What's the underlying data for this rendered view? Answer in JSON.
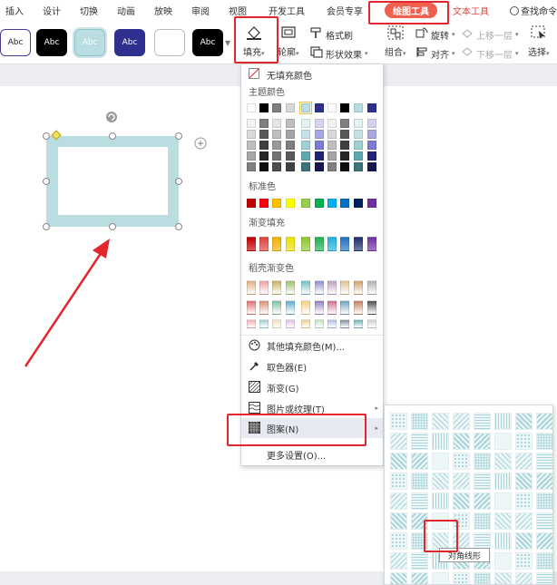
{
  "tabs": [
    "插入",
    "设计",
    "切换",
    "动画",
    "放映",
    "审阅",
    "视图",
    "开发工具",
    "会员专享",
    "绘图工具",
    "文本工具"
  ],
  "search_label": "查找命令",
  "style_swatches": [
    {
      "label": "Abc",
      "bg": "#ffffff",
      "fg": "#222222",
      "border": "#4a3b9a"
    },
    {
      "label": "Abc",
      "bg": "#000000",
      "fg": "#ffffff",
      "border": "#000000"
    },
    {
      "label": "Abc",
      "bg": "#b9dde0",
      "fg": "#ffffff",
      "border": "#8cc5ca"
    },
    {
      "label": "Abc",
      "bg": "#2f2f8f",
      "fg": "#ffffff",
      "border": "#2f2f8f"
    },
    {
      "label": "",
      "bg": "#ffffff",
      "fg": "#222222",
      "border": "#bbbbbb"
    },
    {
      "label": "Abc",
      "bg": "#000000",
      "fg": "#ffffff",
      "border": "#000000"
    }
  ],
  "toolbar": {
    "fill_label": "填充",
    "outline_label": "轮廓",
    "format_painter_label": "格式刷",
    "shape_effect_label": "形状效果",
    "rotate_label": "旋转",
    "bring_forward_label": "上移一层",
    "send_backward_label": "下移一层",
    "group_label": "组合",
    "align_label": "对齐",
    "select_label": "选择"
  },
  "fill_menu": {
    "no_fill": "无填充颜色",
    "theme_colors_title": "主题颜色",
    "standard_colors_title": "标准色",
    "gradient_fill_title": "渐变填充",
    "shell_gradient_title": "稻壳渐变色",
    "more_fill_colors": "其他填充颜色(M)...",
    "eyedropper": "取色器(E)",
    "gradient": "渐变(G)",
    "picture_texture": "图片或纹理(T)",
    "pattern": "图案(N)",
    "more_settings": "更多设置(O)..."
  },
  "theme_top_row": [
    "#ffffff",
    "#000000",
    "#7f7f7f",
    "#d9d9d9",
    "#b9dde0",
    "#2f2f8f",
    "#ffffff",
    "#000000",
    "#b9dde0",
    "#2f2f8f"
  ],
  "theme_columns": [
    [
      "#f2f2f2",
      "#d9d9d9",
      "#bfbfbf",
      "#a6a6a6",
      "#808080"
    ],
    [
      "#7f7f7f",
      "#595959",
      "#404040",
      "#262626",
      "#0d0d0d"
    ],
    [
      "#e6e6e6",
      "#bfbfbf",
      "#999999",
      "#737373",
      "#4d4d4d"
    ],
    [
      "#bfbfbf",
      "#a6a6a6",
      "#7f7f7f",
      "#595959",
      "#404040"
    ],
    [
      "#e2f1f2",
      "#c5e3e6",
      "#9fd0d4",
      "#5da9b0",
      "#3b7479"
    ],
    [
      "#d3d3f0",
      "#a7a7e1",
      "#7c7cd2",
      "#232376",
      "#17174f"
    ],
    [
      "#f2f2f2",
      "#d9d9d9",
      "#bfbfbf",
      "#a6a6a6",
      "#808080"
    ],
    [
      "#7f7f7f",
      "#595959",
      "#404040",
      "#262626",
      "#0d0d0d"
    ],
    [
      "#e2f1f2",
      "#c5e3e6",
      "#9fd0d4",
      "#5da9b0",
      "#3b7479"
    ],
    [
      "#d3d3f0",
      "#a7a7e1",
      "#7c7cd2",
      "#232376",
      "#17174f"
    ]
  ],
  "standard_colors": [
    "#c00000",
    "#ff0000",
    "#ffc000",
    "#ffff00",
    "#92d050",
    "#00b050",
    "#00b0f0",
    "#0070c0",
    "#002060",
    "#7030a0"
  ],
  "gradient_colors": [
    "#c00000",
    "#e0403a",
    "#f0b000",
    "#e8e000",
    "#8cc830",
    "#20b050",
    "#20b0e0",
    "#2070c0",
    "#203070",
    "#7030a0"
  ],
  "shell_rows": [
    [
      "#e0b080",
      "#f0a0a0",
      "#c8b060",
      "#a0c070",
      "#70c0c0",
      "#9090d0",
      "#c0a0c0",
      "#e0c090",
      "#d0a070",
      "#b0b0b0"
    ],
    [
      "#e07070",
      "#e09070",
      "#80c0a0",
      "#60b0d0",
      "#f0d080",
      "#9080c0",
      "#d07090",
      "#70a0c0",
      "#c08060",
      "#505050"
    ],
    [
      "#f0b0b0",
      "#a0d0d0",
      "#f0e0c0",
      "#e0c0e0",
      "#f0d090",
      "#c0e0c0",
      "#b0c0e0",
      "#8090a0",
      "#70b0b0",
      "#d0d0d0"
    ]
  ],
  "pattern_tooltip": "对角线形"
}
